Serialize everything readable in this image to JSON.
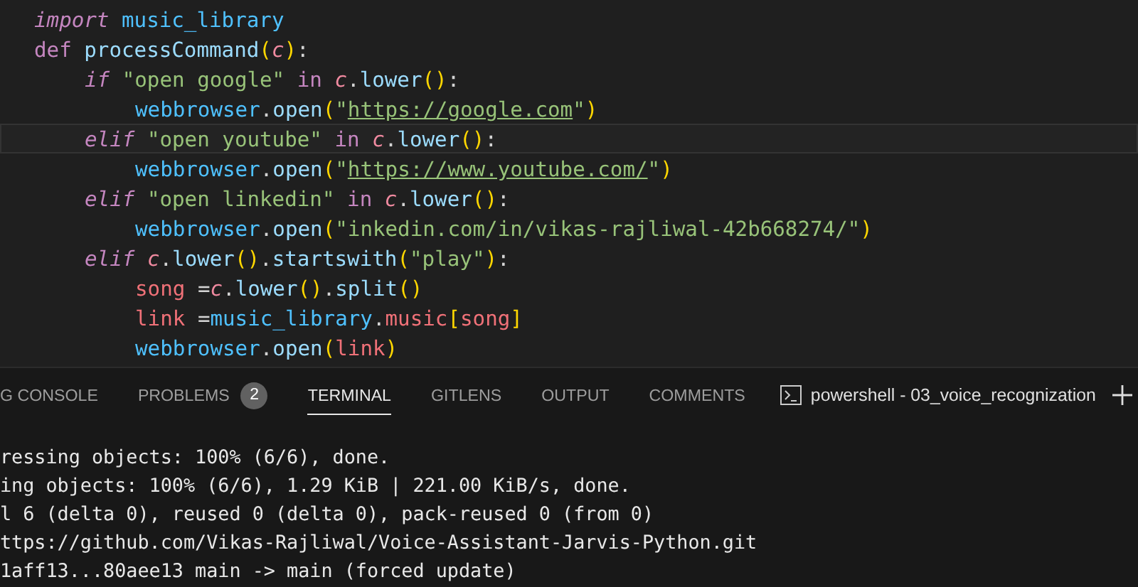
{
  "editor": {
    "lines": [
      {
        "current": false,
        "tokens": [
          {
            "kind": "keyword",
            "text": "import"
          },
          {
            "kind": "module",
            "text": " music_library"
          }
        ]
      },
      {
        "current": false,
        "tokens": [
          {
            "kind": "storage",
            "text": "def"
          },
          {
            "kind": "function",
            "text": " processCommand"
          },
          {
            "kind": "paren",
            "text": "("
          },
          {
            "kind": "param",
            "text": "c"
          },
          {
            "kind": "paren",
            "text": ")"
          },
          {
            "kind": "plain",
            "text": ":"
          }
        ],
        "children": [
          {
            "current": false,
            "tokens": [
              {
                "kind": "keyword",
                "text": "if"
              },
              {
                "kind": "string",
                "text": " \"open google\""
              },
              {
                "kind": "operator",
                "text": " in"
              },
              {
                "kind": "param",
                "text": " c"
              },
              {
                "kind": "plain",
                "text": "."
              },
              {
                "kind": "function",
                "text": "lower"
              },
              {
                "kind": "paren",
                "text": "()"
              },
              {
                "kind": "plain",
                "text": ":"
              }
            ],
            "children": [
              {
                "current": false,
                "tokens": [
                  {
                    "kind": "module",
                    "text": "webbrowser"
                  },
                  {
                    "kind": "plain",
                    "text": "."
                  },
                  {
                    "kind": "function",
                    "text": "open"
                  },
                  {
                    "kind": "paren",
                    "text": "("
                  },
                  {
                    "kind": "string",
                    "text": "\""
                  },
                  {
                    "kind": "link",
                    "text": "https://google.com"
                  },
                  {
                    "kind": "string",
                    "text": "\""
                  },
                  {
                    "kind": "paren",
                    "text": ")"
                  }
                ]
              }
            ]
          },
          {
            "current": true,
            "tokens": [
              {
                "kind": "keyword",
                "text": "elif"
              },
              {
                "kind": "string",
                "text": " \"open youtube\""
              },
              {
                "kind": "operator",
                "text": " in"
              },
              {
                "kind": "param",
                "text": " c"
              },
              {
                "kind": "plain",
                "text": "."
              },
              {
                "kind": "function",
                "text": "lower"
              },
              {
                "kind": "paren",
                "text": "()"
              },
              {
                "kind": "plain",
                "text": ":"
              }
            ],
            "children": [
              {
                "current": false,
                "tokens": [
                  {
                    "kind": "module",
                    "text": "webbrowser"
                  },
                  {
                    "kind": "plain",
                    "text": "."
                  },
                  {
                    "kind": "function",
                    "text": "open"
                  },
                  {
                    "kind": "paren",
                    "text": "("
                  },
                  {
                    "kind": "string",
                    "text": "\""
                  },
                  {
                    "kind": "link",
                    "text": "https://www.youtube.com/"
                  },
                  {
                    "kind": "string",
                    "text": "\""
                  },
                  {
                    "kind": "paren",
                    "text": ")"
                  }
                ]
              }
            ]
          },
          {
            "current": false,
            "tokens": [
              {
                "kind": "keyword",
                "text": "elif"
              },
              {
                "kind": "string",
                "text": " \"open linkedin\""
              },
              {
                "kind": "operator",
                "text": " in"
              },
              {
                "kind": "param",
                "text": " c"
              },
              {
                "kind": "plain",
                "text": "."
              },
              {
                "kind": "function",
                "text": "lower"
              },
              {
                "kind": "paren",
                "text": "()"
              },
              {
                "kind": "plain",
                "text": ":"
              }
            ],
            "children": [
              {
                "current": false,
                "tokens": [
                  {
                    "kind": "module",
                    "text": "webbrowser"
                  },
                  {
                    "kind": "plain",
                    "text": "."
                  },
                  {
                    "kind": "function",
                    "text": "open"
                  },
                  {
                    "kind": "paren",
                    "text": "("
                  },
                  {
                    "kind": "string",
                    "text": "\"inkedin.com/in/vikas-rajliwal-42b668274/\""
                  },
                  {
                    "kind": "paren",
                    "text": ")"
                  }
                ]
              }
            ]
          },
          {
            "current": false,
            "tokens": [
              {
                "kind": "keyword",
                "text": "elif"
              },
              {
                "kind": "param",
                "text": " c"
              },
              {
                "kind": "plain",
                "text": "."
              },
              {
                "kind": "function",
                "text": "lower"
              },
              {
                "kind": "paren",
                "text": "()"
              },
              {
                "kind": "plain",
                "text": "."
              },
              {
                "kind": "function",
                "text": "startswith"
              },
              {
                "kind": "paren",
                "text": "("
              },
              {
                "kind": "string",
                "text": "\"play\""
              },
              {
                "kind": "paren",
                "text": ")"
              },
              {
                "kind": "plain",
                "text": ":"
              }
            ],
            "children": [
              {
                "current": false,
                "tokens": [
                  {
                    "kind": "variable",
                    "text": "song"
                  },
                  {
                    "kind": "plain",
                    "text": " ="
                  },
                  {
                    "kind": "param",
                    "text": "c"
                  },
                  {
                    "kind": "plain",
                    "text": "."
                  },
                  {
                    "kind": "function",
                    "text": "lower"
                  },
                  {
                    "kind": "paren",
                    "text": "()"
                  },
                  {
                    "kind": "plain",
                    "text": "."
                  },
                  {
                    "kind": "function",
                    "text": "split"
                  },
                  {
                    "kind": "paren",
                    "text": "()"
                  }
                ]
              },
              {
                "current": false,
                "tokens": [
                  {
                    "kind": "variable",
                    "text": "link"
                  },
                  {
                    "kind": "plain",
                    "text": " ="
                  },
                  {
                    "kind": "module",
                    "text": "music_library"
                  },
                  {
                    "kind": "plain",
                    "text": "."
                  },
                  {
                    "kind": "variable",
                    "text": "music"
                  },
                  {
                    "kind": "paren",
                    "text": "["
                  },
                  {
                    "kind": "variable",
                    "text": "song"
                  },
                  {
                    "kind": "paren",
                    "text": "]"
                  }
                ]
              },
              {
                "current": false,
                "tokens": [
                  {
                    "kind": "module",
                    "text": "webbrowser"
                  },
                  {
                    "kind": "plain",
                    "text": "."
                  },
                  {
                    "kind": "function",
                    "text": "open"
                  },
                  {
                    "kind": "paren",
                    "text": "("
                  },
                  {
                    "kind": "variable",
                    "text": "link"
                  },
                  {
                    "kind": "paren",
                    "text": ")"
                  }
                ]
              }
            ]
          }
        ]
      }
    ]
  },
  "panel": {
    "tabs": [
      {
        "label": "G CONSOLE",
        "selected": false
      },
      {
        "label": "PROBLEMS",
        "selected": false,
        "badge": "2"
      },
      {
        "label": "TERMINAL",
        "selected": true
      },
      {
        "label": "GITLENS",
        "selected": false
      },
      {
        "label": "OUTPUT",
        "selected": false
      },
      {
        "label": "COMMENTS",
        "selected": false
      }
    ],
    "terminal_name": "powershell - 03_voice_recognization"
  },
  "terminal": {
    "lines": [
      "ressing objects: 100% (6/6), done.",
      "ing objects: 100% (6/6), 1.29 KiB | 221.00 KiB/s, done.",
      "l 6 (delta 0), reused 0 (delta 0), pack-reused 0 (from 0)",
      "ttps://github.com/Vikas-Rajliwal/Voice-Assistant-Jarvis-Python.git",
      "1aff13...80aee13 main -> main (forced update)"
    ]
  }
}
